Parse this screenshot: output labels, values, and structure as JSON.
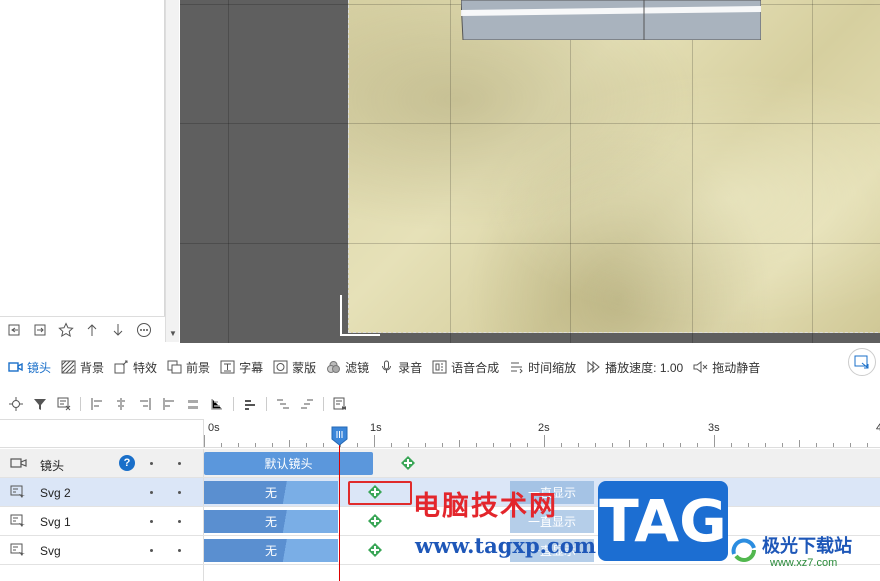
{
  "menubar": {
    "items": [
      {
        "label": "镜头",
        "icon": "camera-icon",
        "active": true
      },
      {
        "label": "背景",
        "icon": "background-icon"
      },
      {
        "label": "特效",
        "icon": "effects-icon"
      },
      {
        "label": "前景",
        "icon": "foreground-icon"
      },
      {
        "label": "字幕",
        "icon": "subtitle-icon"
      },
      {
        "label": "蒙版",
        "icon": "mask-icon"
      },
      {
        "label": "滤镜",
        "icon": "filter-icon"
      },
      {
        "label": "录音",
        "icon": "microphone-icon"
      },
      {
        "label": "语音合成",
        "icon": "speech-synthesis-icon"
      },
      {
        "label": "时间缩放",
        "icon": "time-scale-icon"
      },
      {
        "label": "播放速度: 1.00",
        "icon": "playback-speed-icon"
      },
      {
        "label": "拖动静音",
        "icon": "mute-icon"
      }
    ]
  },
  "ruler": {
    "labels": [
      "0s",
      "1s",
      "2s",
      "3s",
      "4"
    ]
  },
  "tracks": [
    {
      "name": "镜头",
      "clip": "默认镜头"
    },
    {
      "name": "Svg 2",
      "clip": "无"
    },
    {
      "name": "Svg 1",
      "clip": "无"
    },
    {
      "name": "Svg",
      "clip": "无"
    }
  ],
  "ghost_clips": [
    "一直显示",
    "一直显示",
    "一直显示"
  ],
  "help_label": "?",
  "watermark": {
    "title": "电脑技术网",
    "url": "www.tagxp.com",
    "tag": "TAG",
    "brand": "极光下载站",
    "brand_url": "www.xz7.com"
  },
  "colors": {
    "accent": "#1a6fc9",
    "clip": "#5a8fd0",
    "playhead": "#dd0000",
    "keyframe": "#3aa657"
  }
}
